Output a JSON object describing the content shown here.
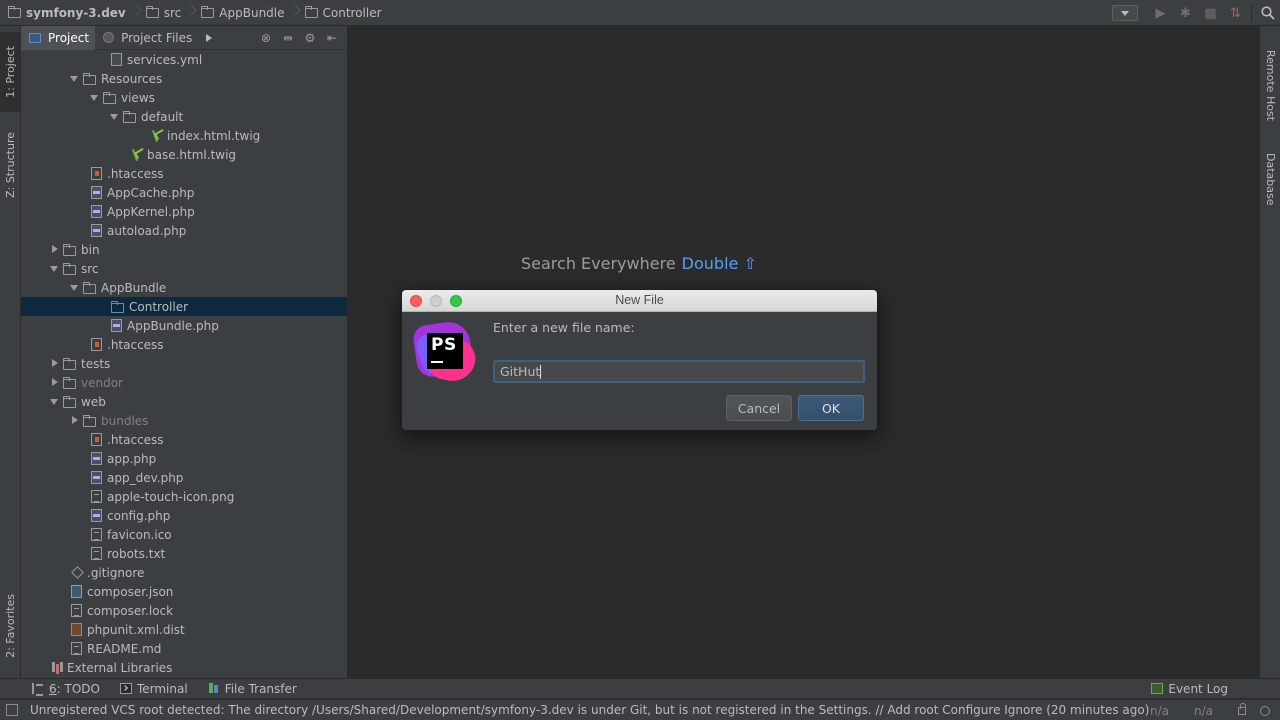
{
  "breadcrumbs": [
    "symfony-3.dev",
    "src",
    "AppBundle",
    "Controller"
  ],
  "left_tool_windows": [
    "1: Project",
    "Z: Structure",
    "2: Favorites"
  ],
  "right_tool_windows": [
    "Remote Host",
    "Database"
  ],
  "project_panel": {
    "tabs": [
      "Project",
      "Project Files"
    ]
  },
  "tree": [
    {
      "label": "services.yml",
      "depth": 4,
      "icon": "yml-file-icon",
      "arrow": "none"
    },
    {
      "label": "Resources",
      "depth": 2,
      "icon": "folder-icon",
      "arrow": "open"
    },
    {
      "label": "views",
      "depth": 3,
      "icon": "folder-icon",
      "arrow": "open"
    },
    {
      "label": "default",
      "depth": 4,
      "icon": "folder-icon",
      "arrow": "open"
    },
    {
      "label": "index.html.twig",
      "depth": 6,
      "icon": "twig-file-icon",
      "arrow": "none"
    },
    {
      "label": "base.html.twig",
      "depth": 5,
      "icon": "twig-file-icon",
      "arrow": "none"
    },
    {
      "label": ".htaccess",
      "depth": 3,
      "icon": "htaccess-file-icon",
      "arrow": "none"
    },
    {
      "label": "AppCache.php",
      "depth": 3,
      "icon": "php-file-icon",
      "arrow": "none"
    },
    {
      "label": "AppKernel.php",
      "depth": 3,
      "icon": "php-file-icon",
      "arrow": "none"
    },
    {
      "label": "autoload.php",
      "depth": 3,
      "icon": "php-file-icon",
      "arrow": "none"
    },
    {
      "label": "bin",
      "depth": 1,
      "icon": "folder-icon",
      "arrow": "closed"
    },
    {
      "label": "src",
      "depth": 1,
      "icon": "folder-icon",
      "arrow": "open"
    },
    {
      "label": "AppBundle",
      "depth": 2,
      "icon": "folder-icon",
      "arrow": "open"
    },
    {
      "label": "Controller",
      "depth": 4,
      "icon": "folder-icon",
      "arrow": "none",
      "selected": true
    },
    {
      "label": "AppBundle.php",
      "depth": 4,
      "icon": "php-file-icon",
      "arrow": "none"
    },
    {
      "label": ".htaccess",
      "depth": 3,
      "icon": "htaccess-file-icon",
      "arrow": "none"
    },
    {
      "label": "tests",
      "depth": 1,
      "icon": "folder-icon",
      "arrow": "closed"
    },
    {
      "label": "vendor",
      "depth": 1,
      "icon": "folder-icon",
      "arrow": "closed",
      "dim": true
    },
    {
      "label": "web",
      "depth": 1,
      "icon": "folder-icon",
      "arrow": "open"
    },
    {
      "label": "bundles",
      "depth": 2,
      "icon": "folder-icon",
      "arrow": "closed",
      "dim": true
    },
    {
      "label": ".htaccess",
      "depth": 3,
      "icon": "htaccess-file-icon",
      "arrow": "none"
    },
    {
      "label": "app.php",
      "depth": 3,
      "icon": "php-file-icon",
      "arrow": "none"
    },
    {
      "label": "app_dev.php",
      "depth": 3,
      "icon": "php-file-icon",
      "arrow": "none"
    },
    {
      "label": "apple-touch-icon.png",
      "depth": 3,
      "icon": "image-file-icon",
      "arrow": "none"
    },
    {
      "label": "config.php",
      "depth": 3,
      "icon": "php-file-icon",
      "arrow": "none"
    },
    {
      "label": "favicon.ico",
      "depth": 3,
      "icon": "image-file-icon",
      "arrow": "none"
    },
    {
      "label": "robots.txt",
      "depth": 3,
      "icon": "text-file-icon",
      "arrow": "none"
    },
    {
      "label": ".gitignore",
      "depth": 2,
      "icon": "gitignore-file-icon",
      "arrow": "none"
    },
    {
      "label": "composer.json",
      "depth": 2,
      "icon": "json-file-icon",
      "arrow": "none"
    },
    {
      "label": "composer.lock",
      "depth": 2,
      "icon": "text-file-icon",
      "arrow": "none"
    },
    {
      "label": "phpunit.xml.dist",
      "depth": 2,
      "icon": "xml-file-icon",
      "arrow": "none"
    },
    {
      "label": "README.md",
      "depth": 2,
      "icon": "text-file-icon",
      "arrow": "none"
    },
    {
      "label": "External Libraries",
      "depth": 1,
      "icon": "library-icon",
      "arrow": "none"
    }
  ],
  "editor": {
    "hint_text": "Search Everywhere",
    "hint_shortcut": "Double ⇧"
  },
  "dialog": {
    "title": "New File",
    "prompt": "Enter a new file name:",
    "input_value": "GitHut",
    "cancel_label": "Cancel",
    "ok_label": "OK"
  },
  "bottom_tabs": {
    "todo_mnemonic": "6",
    "todo_label": ": TODO",
    "terminal": "Terminal",
    "file_transfer": "File Transfer",
    "event_log": "Event Log"
  },
  "status": {
    "message": "Unregistered VCS root detected: The directory /Users/Shared/Development/symfony-3.dev is under Git, but is not registered in the Settings. // Add root  Configure  Ignore (20 minutes ago)",
    "line_col": "n/a",
    "encoding": "n/a"
  },
  "colors": {
    "accent": "#589df6",
    "selection": "#0d293e",
    "ok_button": "#365880"
  }
}
